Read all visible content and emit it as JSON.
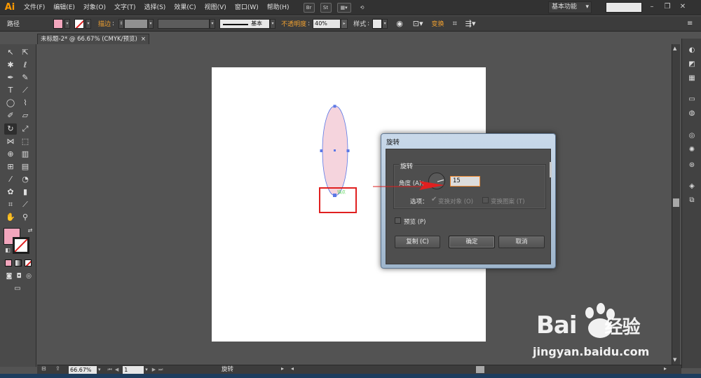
{
  "app": {
    "logo": "Ai"
  },
  "menu": {
    "items": [
      "文件(F)",
      "编辑(E)",
      "对象(O)",
      "文字(T)",
      "选择(S)",
      "效果(C)",
      "视图(V)",
      "窗口(W)",
      "帮助(H)"
    ],
    "br_icon": "Br",
    "st_icon": "St",
    "workspace": "基本功能",
    "search_placeholder": ""
  },
  "control": {
    "path_label": "路径",
    "stroke_label": "描边",
    "brush_label": "基本",
    "opacity_label": "不透明度",
    "opacity_value": "40%",
    "style_label": "样式",
    "transform_label": "变换"
  },
  "document": {
    "tab_title": "未标题-2* @ 66.67% (CMYK/预览)"
  },
  "status": {
    "zoom": "66.67%",
    "page": "1",
    "current_tool": "旋转"
  },
  "dialog": {
    "title": "旋转",
    "group_title": "旋转",
    "angle_label": "角度 (A)：",
    "angle_value": "15",
    "options_label": "选项：",
    "transform_objects": "变换对象 (O)",
    "transform_patterns": "变换图案 (T)",
    "preview_label": "预览 (P)",
    "copy_button": "复制 (C)",
    "ok_button": "确定",
    "cancel_button": "取消"
  },
  "artwork": {
    "anchor_hint": "锚点"
  },
  "watermark": {
    "brand": "Bai",
    "brand_cn": "经验",
    "url": "jingyan.baidu.com"
  },
  "colors": {
    "fill": "#f2a6bd",
    "ellipse_fill": "#f5d4dd",
    "selection": "#5b78e6",
    "highlight": "#e02020",
    "accent": "#ff9a00"
  }
}
